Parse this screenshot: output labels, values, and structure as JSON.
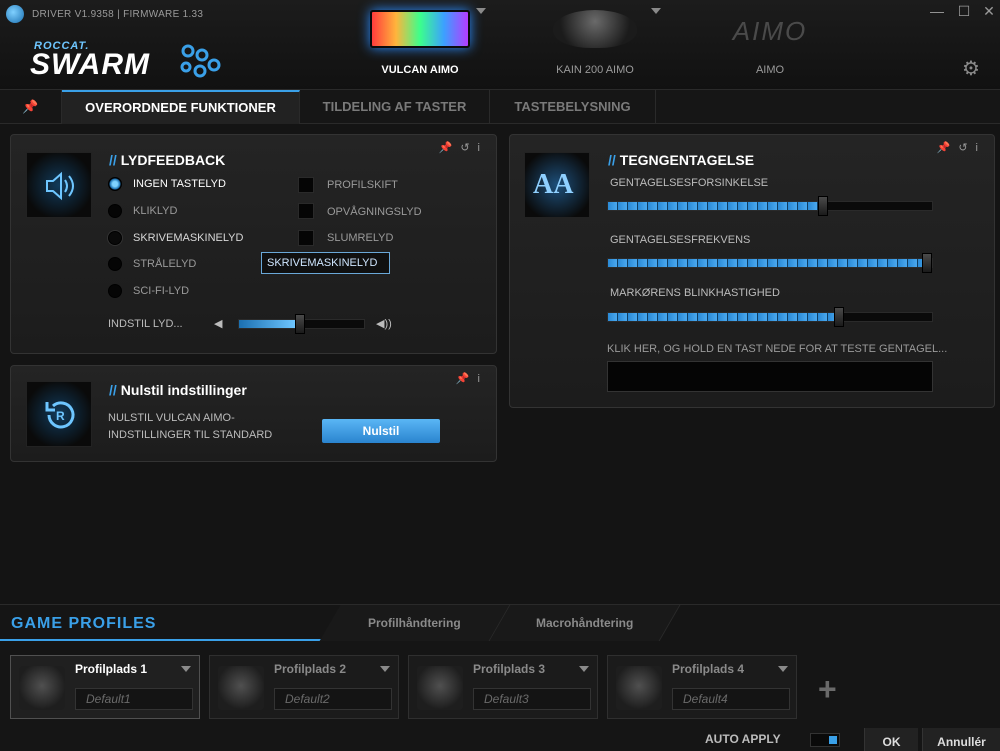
{
  "window": {
    "version": "DRIVER V1.9358 | FIRMWARE 1.33",
    "minimize": "—",
    "maximize": "☐",
    "close": "✕"
  },
  "logo": {
    "sub": "ROCCAT.",
    "main": "SWARM"
  },
  "devices": [
    {
      "label": "VULCAN AIMO",
      "icon": "keyboard-icon",
      "active": true
    },
    {
      "label": "KAIN 200 AIMO",
      "icon": "mouse-icon",
      "active": false
    },
    {
      "label": "AIMO",
      "icon": "aimo-logo",
      "logo_text": "AIMO",
      "active": false
    }
  ],
  "settings_icon": "gear-icon",
  "function_tabs": [
    {
      "label": "OVERORDNEDE FUNKTIONER",
      "active": true
    },
    {
      "label": "TILDELING AF TASTER",
      "active": false
    },
    {
      "label": "TASTEBELYSNING",
      "active": false
    }
  ],
  "sound_feedback": {
    "title": "LYDFEEDBACK",
    "radio_options": [
      {
        "label": "INGEN TASTELYD",
        "selected": true
      },
      {
        "label": "KLIKLYD",
        "selected": false
      },
      {
        "label": "SKRIVEMASKINELYD",
        "selected": false
      },
      {
        "label": "STRÅLELYD",
        "selected": false
      },
      {
        "label": "SCI-FI-LYD",
        "selected": false
      }
    ],
    "checkbox_options": [
      {
        "label": "PROFILSKIFT",
        "checked": false
      },
      {
        "label": "OPVÅGNINGSLYD",
        "checked": false
      },
      {
        "label": "SLUMRELYD",
        "checked": false
      }
    ],
    "tooltip": "SKRIVEMASKINELYD",
    "volume_label": "INDSTIL LYD...",
    "volume_level": 0.49
  },
  "reset": {
    "title": "Nulstil indstillinger",
    "description_line1": "NULSTIL VULCAN AIMO-",
    "description_line2": "INDSTILLINGER TIL STANDARD",
    "button": "Nulstil"
  },
  "char_repeat": {
    "title": "TEGNGENTAGELSE",
    "icon_text": "AA",
    "sliders": [
      {
        "label": "GENTAGELSESFORSINKELSE",
        "value": 0.67
      },
      {
        "label": "GENTAGELSESFREKVENS",
        "value": 1.0
      },
      {
        "label": "MARKØRENS BLINKHASTIGHED",
        "value": 0.72
      }
    ],
    "test_label": "KLIK HER, OG HOLD EN TAST NEDE FOR AT TESTE GENTAGEL..."
  },
  "game_profiles": {
    "title": "GAME PROFILES",
    "tabs": [
      "Profilhåndtering",
      "Macrohåndtering"
    ],
    "profiles": [
      {
        "name": "Profilplads 1",
        "value": "Default1",
        "active": true
      },
      {
        "name": "Profilplads 2",
        "value": "Default2",
        "active": false
      },
      {
        "name": "Profilplads 3",
        "value": "Default3",
        "active": false
      },
      {
        "name": "Profilplads 4",
        "value": "Default4",
        "active": false
      }
    ],
    "add": "+"
  },
  "footer": {
    "auto_apply": "AUTO APPLY",
    "auto_apply_on": true,
    "ok": "OK",
    "cancel": "Annullér"
  },
  "colors": {
    "accent": "#3aa0e8",
    "background": "#141414"
  }
}
